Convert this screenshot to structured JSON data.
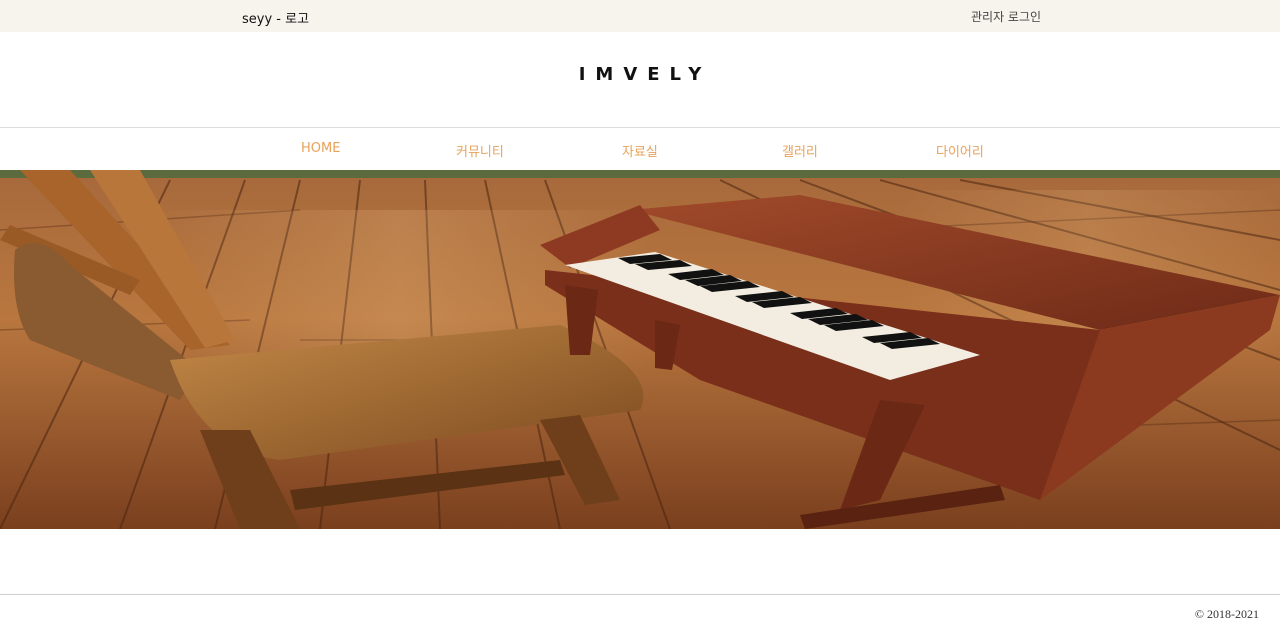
{
  "topbar": {
    "site_link": "seyy - 로고",
    "admin_login": "관리자 로그인"
  },
  "header": {
    "logo_text": "IMVELY"
  },
  "nav": {
    "items": [
      {
        "label": "HOME"
      },
      {
        "label": "커뮤니티"
      },
      {
        "label": "자료실"
      },
      {
        "label": "갤러리"
      },
      {
        "label": "다이어리"
      }
    ]
  },
  "footer": {
    "copyright": "© 2018-2021"
  },
  "colors": {
    "topbar_bg": "#f7f4ee",
    "nav_text": "#e8a25a",
    "deck_wood": "#b8713a",
    "piano_body": "#8e3a22"
  }
}
